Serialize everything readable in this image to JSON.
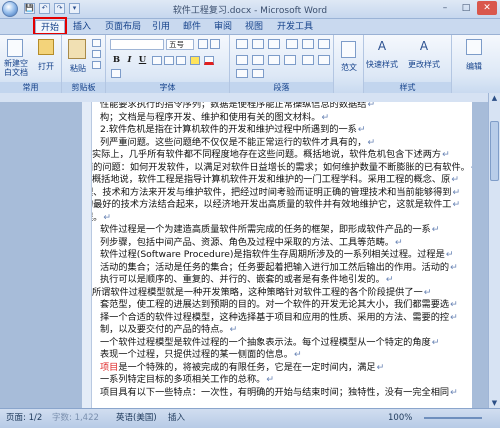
{
  "window": {
    "title": "软件工程复习.docx - Microsoft Word",
    "min": "–",
    "max": "□",
    "close": "✕"
  },
  "quick_access": [
    "💾",
    "↶",
    "↷",
    "▾"
  ],
  "tabs": [
    {
      "label": "开始",
      "active": true
    },
    {
      "label": "插入"
    },
    {
      "label": "页面布局"
    },
    {
      "label": "引用"
    },
    {
      "label": "邮件"
    },
    {
      "label": "审阅"
    },
    {
      "label": "视图"
    },
    {
      "label": "开发工具"
    }
  ],
  "ribbon": {
    "groups": {
      "common": "常用",
      "clipboard": "剪贴板",
      "font": "字体",
      "paragraph": "段落",
      "style": "样式",
      "edit": "编辑"
    },
    "new_blank": "新建空白文档",
    "open": "打开",
    "paste": "粘贴",
    "font_name": "",
    "font_size": "五号",
    "quick_style": "快速样式",
    "change_style": "更改样式",
    "fanwen": "范文",
    "edit_label": "编辑",
    "bold": "B",
    "italic": "I",
    "underline": "U"
  },
  "document": {
    "lines": [
      {
        "text": "性能要求执行的指令序列；数据是使程序能正常操纵信息的数据结",
        "indent": 0
      },
      {
        "text": "构；文档是与程序开发、维护和使用有关的图文材料。",
        "indent": 0
      },
      {
        "text": "2.软件危机是指在计算机软件的开发和维护过程中所遇到的一系",
        "indent": 0
      },
      {
        "text": "列严重问题。这些问题绝不仅仅是不能正常运行的软件才具有的，",
        "indent": 0
      },
      {
        "text": "实际上，几乎所有软件都不同程度地存在这些问题。概括地说，软件危机包含下述两方",
        "indent": 0
      },
      {
        "text": "面的问题：如何开发软件，以满足对软件日益增长的需求；如何维护数量不断膨胀的已有软件。",
        "indent": 0
      },
      {
        "text": "概括地说，软件工程是指导计算机软件开发和维护的一门工程学科。采用工程的概念、原",
        "indent": 0
      },
      {
        "text": "理、技术和方法来开发与维护软件，把经过时间考验而证明正确的管理技术和当前能够得到",
        "indent": 0
      },
      {
        "text": "的最好的技术方法结合起来，以经济地开发出高质量的软件并有效地维护它，这就是软件工",
        "indent": 0
      },
      {
        "text": "程。",
        "indent": 0
      },
      {
        "text": "软件过程是一个为建造高质量软件所需完成的任务的框架，即形成软件产品的一系",
        "indent": 0
      },
      {
        "text": "列步骤，包括中间产品、资源、角色及过程中采取的方法、工具等范畴。",
        "indent": 0
      },
      {
        "text": "软件过程(Software Procedure)是指软件生存周期所涉及的一系列相关过程。过程是",
        "indent": 0
      },
      {
        "text": "活动的集合；活动是任务的集合；任务要起着把输入进行加工然后输出的作用。活动的",
        "indent": 0
      },
      {
        "text": "执行可以是顺序的、重复的、并行的、嵌套的或者是有条件地引发的。",
        "indent": 0
      },
      {
        "text": "所谓软件过程模型就是一种开发策略，这种策略针对软件工程的各个阶段提供了一",
        "indent": 0
      },
      {
        "text": "套范型，使工程的进展达到预期的目的。对一个软件的开发无论其大小，我们都需要选",
        "indent": 0
      },
      {
        "text": "择一个合适的软件过程模型，这种选择基于项目和应用的性质、采用的方法、需要的控",
        "indent": 0
      },
      {
        "text": "制，以及要交付的产品的特点。",
        "indent": 0
      },
      {
        "text": "一个软件过程模型是软件过程的一个抽象表示法。每个过程模型从一个特定的角度",
        "indent": 0
      },
      {
        "text": "表现一个过程，只提供过程的某一侧面的信息。",
        "indent": 0
      },
      {
        "text": "项目是一个特殊的，将被完成的有限任务，它是在一定时间内，满足",
        "indent": 0
      },
      {
        "text": "一系列特定目标的多项相关工作的总称。",
        "indent": 0
      },
      {
        "text": "项目具有以下一些特点：一次性，有明确的开始与结束时间；独特性，没有一完全相同",
        "indent": 0
      }
    ]
  },
  "status": {
    "page": "页面: 1/2",
    "words": "字数: 1,422",
    "lang": "英语(美国)",
    "insert": "插入",
    "zoom": "100%"
  },
  "colors": {
    "accent": "#15428b",
    "highlight_box": "#e30000"
  }
}
